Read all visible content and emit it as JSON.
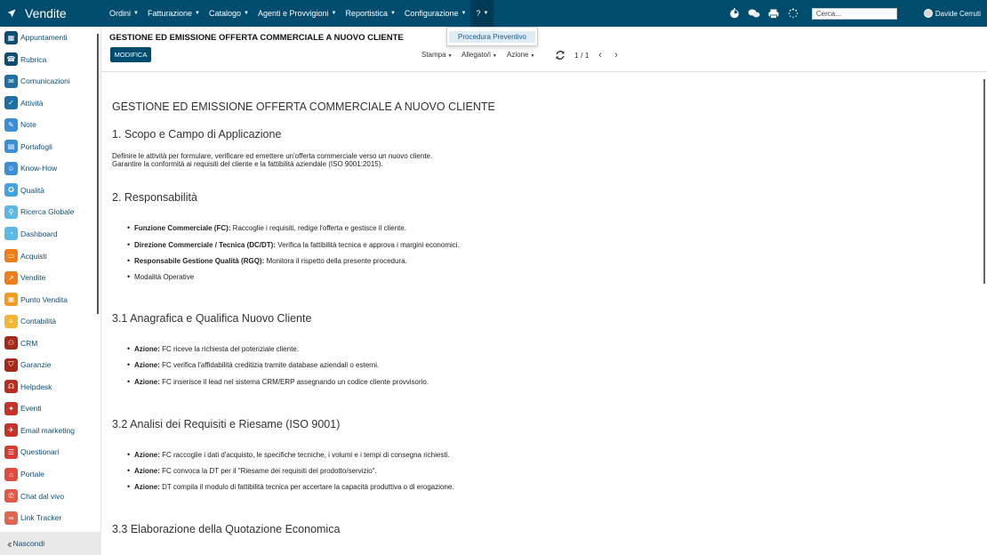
{
  "app": {
    "title": "Vendite"
  },
  "menu": [
    {
      "label": "Ordini"
    },
    {
      "label": "Fatturazione"
    },
    {
      "label": "Catalogo"
    },
    {
      "label": "Agenti e Provvigioni"
    },
    {
      "label": "Reportistica"
    },
    {
      "label": "Configurazione"
    },
    {
      "label": "?"
    }
  ],
  "dropdown": {
    "item": "Procedura Preventivo"
  },
  "search": {
    "placeholder": "Cerca..."
  },
  "user": {
    "name": "Davide Cerruti"
  },
  "sidebar": {
    "items": [
      {
        "label": "Appuntamenti",
        "icon": "calendar-icon",
        "color": "#0e4e73"
      },
      {
        "label": "Rubrica",
        "icon": "contacts-icon",
        "color": "#0e4e73"
      },
      {
        "label": "Comunicazioni",
        "icon": "chat-icon",
        "color": "#1e6fa3"
      },
      {
        "label": "Attività",
        "icon": "check-icon",
        "color": "#1e6fa3"
      },
      {
        "label": "Note",
        "icon": "note-icon",
        "color": "#3a8fd6"
      },
      {
        "label": "Portafogli",
        "icon": "wallet-icon",
        "color": "#3a8fd6"
      },
      {
        "label": "Know-How",
        "icon": "head-icon",
        "color": "#3a8fd6"
      },
      {
        "label": "Qualità",
        "icon": "quality-icon",
        "color": "#40a4e0"
      },
      {
        "label": "Ricerca Globale",
        "icon": "search-icon",
        "color": "#5bb8e8"
      },
      {
        "label": "Dashboard",
        "icon": "dashboard-icon",
        "color": "#5bb8e8"
      },
      {
        "label": "Acquisti",
        "icon": "purchase-icon",
        "color": "#ee7d1a"
      },
      {
        "label": "Vendite",
        "icon": "sales-icon",
        "color": "#ee7d1a"
      },
      {
        "label": "Punto Vendita",
        "icon": "pos-icon",
        "color": "#f29a22"
      },
      {
        "label": "Contabilità",
        "icon": "accounting-icon",
        "color": "#f5b731"
      },
      {
        "label": "CRM",
        "icon": "crm-icon",
        "color": "#a52a1a"
      },
      {
        "label": "Garanzie",
        "icon": "shield-icon",
        "color": "#a52a1a"
      },
      {
        "label": "Helpdesk",
        "icon": "headset-icon",
        "color": "#b82d22"
      },
      {
        "label": "Eventi",
        "icon": "event-icon",
        "color": "#c8302a"
      },
      {
        "label": "Email marketing",
        "icon": "email-icon",
        "color": "#c8302a"
      },
      {
        "label": "Questionari",
        "icon": "survey-icon",
        "color": "#d83a34"
      },
      {
        "label": "Portale",
        "icon": "portal-icon",
        "color": "#e04a40"
      },
      {
        "label": "Chat dal vivo",
        "icon": "livechat-icon",
        "color": "#e05a48"
      },
      {
        "label": "Link Tracker",
        "icon": "link-icon",
        "color": "#e06650"
      }
    ],
    "hide_label": "Nascondi"
  },
  "panel": {
    "title": "GESTIONE ED EMISSIONE OFFERTA COMMERCIALE A NUOVO CLIENTE",
    "edit_label": "MODIFICA",
    "print_label": "Stampa",
    "attach_label": "Allegato/i",
    "action_label": "Azione",
    "pager": "1 / 1"
  },
  "doc": {
    "title": "GESTIONE ED EMISSIONE OFFERTA COMMERCIALE A NUOVO CLIENTE",
    "s1": {
      "heading": "1. Scopo e Campo di Applicazione",
      "line1": "Definire le attività per formulare, verificare ed emettere un'offerta commerciale verso un nuovo cliente.",
      "line2": "Garantire la conformità ai requisiti del cliente e la fattibilità aziendale (ISO 9001:2015)."
    },
    "s2": {
      "heading": "2. Responsabilità",
      "b1_bold": "Funzione Commerciale (FC):",
      "b1_text": " Raccoglie i requisiti, redige l'offerta e gestisce il cliente.",
      "b2_bold": "Direzione Commerciale / Tecnica (DC/DT):",
      "b2_text": " Verifica la fattibilità tecnica e approva i margini economici.",
      "b3_bold": "Responsabile Gestione Qualità (RGQ):",
      "b3_text": " Monitora il rispetto della presente procedura.",
      "b4_text": "Modalità Operative"
    },
    "s31": {
      "heading": "3.1 Anagrafica e Qualifica Nuovo Cliente",
      "b1_bold": "Azione:",
      "b1_text": " FC riceve la richiesta del potenziale cliente.",
      "b2_bold": "Azione:",
      "b2_text": " FC verifica l'affidabilità creditizia tramite database aziendali o esterni.",
      "b3_bold": "Azione:",
      "b3_text": " FC inserisce il lead nel sistema CRM/ERP assegnando un codice cliente provvisorio."
    },
    "s32": {
      "heading": "3.2 Analisi dei Requisiti e Riesame (ISO 9001)",
      "b1_bold": "Azione:",
      "b1_text": " FC raccoglie i dati d'acquisto, le specifiche tecniche, i volumi e i tempi di consegna richiesti.",
      "b2_bold": "Azione:",
      "b2_text": " FC convoca la DT per il \"Riesame dei requisiti del prodotto/servizio\".",
      "b3_bold": "Azione:",
      "b3_text": " DT compila il modulo di fattibilità tecnica per accertare la capacità produttiva o di erogazione."
    },
    "s33": {
      "heading": "3.3 Elaborazione della Quotazione Economica"
    }
  }
}
